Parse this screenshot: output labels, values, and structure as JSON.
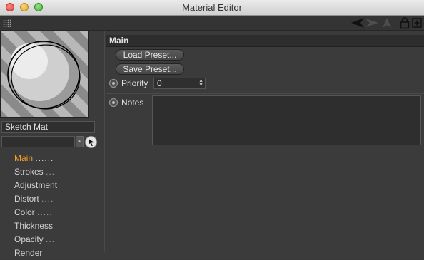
{
  "window": {
    "title": "Material Editor"
  },
  "toolbar": {
    "icons": [
      "grip-icon",
      "arrow-left-icon",
      "arrow-right-icon",
      "up-icon",
      "lock-icon",
      "new-window-icon"
    ]
  },
  "material": {
    "name": "Sketch Mat",
    "search_value": ""
  },
  "channels": [
    {
      "label": "Main",
      "dots": "......",
      "active": true
    },
    {
      "label": "Strokes",
      "dots": "...",
      "active": false
    },
    {
      "label": "Adjustment",
      "dots": "",
      "active": false
    },
    {
      "label": "Distort",
      "dots": "....",
      "active": false
    },
    {
      "label": "Color",
      "dots": ".....",
      "active": false
    },
    {
      "label": "Thickness",
      "dots": "",
      "active": false
    },
    {
      "label": "Opacity",
      "dots": "...",
      "active": false
    },
    {
      "label": "Render",
      "dots": "",
      "active": false
    }
  ],
  "main": {
    "section_title": "Main",
    "load_preset": "Load Preset...",
    "save_preset": "Save Preset...",
    "priority_label": "Priority",
    "priority_value": "0",
    "notes_label": "Notes",
    "notes_value": ""
  },
  "colors": {
    "active_channel": "#f0a020",
    "background": "#3b3b3b"
  }
}
